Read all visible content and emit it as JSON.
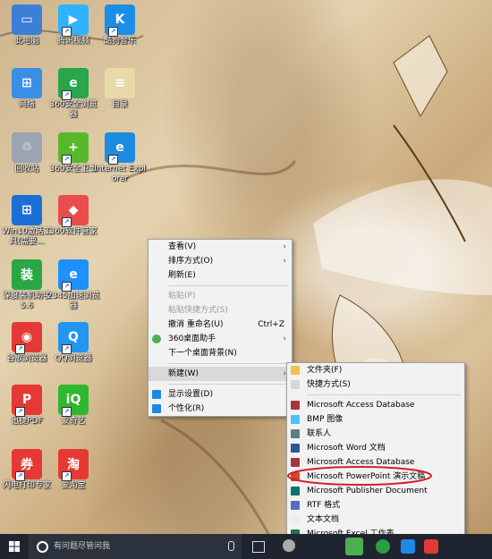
{
  "desktop": {
    "icons": [
      {
        "label": "此电脑",
        "color": "#3b7fd6",
        "glyph": "▭",
        "icon": "computer-icon",
        "shortcut": false
      },
      {
        "label": "腾讯视频",
        "color": "#2fb3ff",
        "glyph": "▶",
        "icon": "video-icon",
        "shortcut": true
      },
      {
        "label": "酷狗音乐",
        "color": "#1a8fe8",
        "glyph": "K",
        "icon": "music-icon",
        "shortcut": true
      },
      {
        "label": "网络",
        "color": "#3a8ee6",
        "glyph": "⊞",
        "icon": "network-icon",
        "shortcut": false
      },
      {
        "label": "360安全浏览器",
        "color": "#27a64a",
        "glyph": "e",
        "icon": "browser-icon",
        "shortcut": true
      },
      {
        "label": "目录",
        "color": "#e8d9a8",
        "glyph": "≡",
        "icon": "document-icon",
        "shortcut": false
      },
      {
        "label": "回收站",
        "color": "#9aa5b1",
        "glyph": "♲",
        "icon": "recycle-bin-icon",
        "shortcut": false
      },
      {
        "label": "360安全卫士",
        "color": "#58b82c",
        "glyph": "+",
        "icon": "security-icon",
        "shortcut": true
      },
      {
        "label": "Internet Explorer",
        "color": "#1d8be0",
        "glyph": "e",
        "icon": "ie-icon",
        "shortcut": true
      },
      {
        "label": "Win10激活工具(需要...",
        "color": "#1c6fd6",
        "glyph": "⊞",
        "icon": "windows-icon",
        "shortcut": false
      },
      {
        "label": "360软件管家",
        "color": "#e94e4e",
        "glyph": "◆",
        "icon": "software-manager-icon",
        "shortcut": true
      },
      {
        "label": "深度装机助手5.6",
        "color": "#28a745",
        "glyph": "装",
        "icon": "installer-icon",
        "shortcut": false
      },
      {
        "label": "2345加速浏览器",
        "color": "#1e90ff",
        "glyph": "e",
        "icon": "browser-2345-icon",
        "shortcut": true
      },
      {
        "label": "谷歌浏览器",
        "color": "#e53935",
        "glyph": "◉",
        "icon": "chrome-icon",
        "shortcut": true
      },
      {
        "label": "QQ浏览器",
        "color": "#2196f3",
        "glyph": "Q",
        "icon": "qq-browser-icon",
        "shortcut": true
      },
      {
        "label": "迅捷PDF",
        "color": "#e53935",
        "glyph": "P",
        "icon": "pdf-icon",
        "shortcut": true
      },
      {
        "label": "爱奇艺",
        "color": "#2eb82e",
        "glyph": "iQ",
        "icon": "iqiyi-icon",
        "shortcut": true
      },
      {
        "label": "闪电打印专家",
        "color": "#e53935",
        "glyph": "券",
        "icon": "coupon-icon",
        "shortcut": true
      },
      {
        "label": "爱淘宝",
        "color": "#e53935",
        "glyph": "淘",
        "icon": "taobao-icon",
        "shortcut": true
      }
    ]
  },
  "context_menu": {
    "items": [
      {
        "label": "查看(V)",
        "arrow": "›"
      },
      {
        "label": "排序方式(O)",
        "arrow": "›"
      },
      {
        "label": "刷新(E)"
      },
      {
        "sep": true
      },
      {
        "label": "粘贴(P)",
        "disabled": true
      },
      {
        "label": "粘贴快捷方式(S)",
        "disabled": true
      },
      {
        "label": "撤消 重命名(U)",
        "acc": "Ctrl+Z"
      },
      {
        "label": "360桌面助手",
        "arrow": "›",
        "icon": "360-icon"
      },
      {
        "label": "下一个桌面背景(N)"
      },
      {
        "sep": true
      },
      {
        "label": "新建(W)",
        "arrow": "›",
        "hl": true
      },
      {
        "sep": true
      },
      {
        "label": "显示设置(D)",
        "icon": "display-icon"
      },
      {
        "label": "个性化(R)",
        "icon": "personalize-icon"
      }
    ]
  },
  "new_submenu": {
    "items": [
      {
        "label": "文件夹(F)",
        "icon": "folder-icon"
      },
      {
        "label": "快捷方式(S)",
        "icon": "shortcut-icon"
      },
      {
        "sep": true
      },
      {
        "label": "Microsoft Access Database",
        "icon": "access-icon"
      },
      {
        "label": "BMP 图像",
        "icon": "bmp-icon"
      },
      {
        "label": "联系人",
        "icon": "contact-icon"
      },
      {
        "label": "Microsoft Word 文档",
        "icon": "word-icon"
      },
      {
        "label": "Microsoft Access Database",
        "icon": "access-icon"
      },
      {
        "label": "Microsoft PowerPoint 演示文稿",
        "icon": "powerpoint-icon",
        "circled": true
      },
      {
        "label": "Microsoft Publisher Document",
        "icon": "publisher-icon"
      },
      {
        "label": "RTF 格式",
        "icon": "rtf-icon"
      },
      {
        "label": "文本文档",
        "icon": "text-icon"
      },
      {
        "label": "Microsoft Excel 工作表",
        "icon": "excel-icon"
      }
    ]
  },
  "taskbar": {
    "search_placeholder": "有问题尽管问我"
  },
  "colors": {
    "highlight_circle": "#d0202a",
    "taskbar": "#1e2530"
  }
}
